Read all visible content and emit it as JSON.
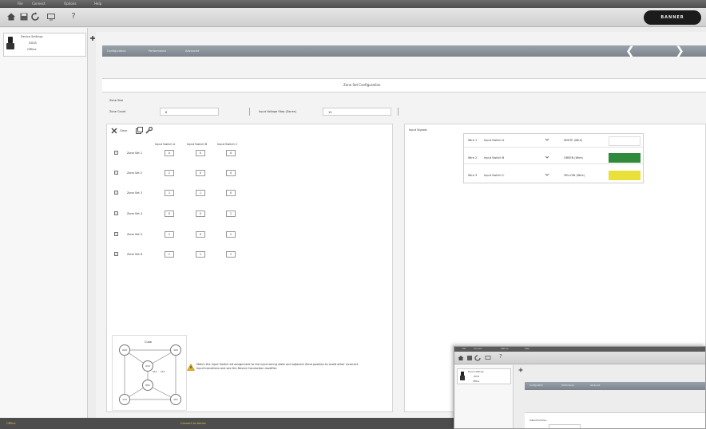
{
  "menu": {
    "items": [
      "File",
      "Connect",
      "Options",
      "Help"
    ]
  },
  "toolbar": {
    "icons": [
      "home-icon",
      "save-icon",
      "refresh-icon",
      "monitor-icon",
      "help-icon"
    ],
    "help_glyph": "?"
  },
  "brand": {
    "logo_text": "BANNER"
  },
  "device": {
    "name": "Device Settings",
    "model": "DXI-B",
    "status": "Offline"
  },
  "nav": {
    "tabs": [
      "Configuration",
      "Performance",
      "Advanced"
    ],
    "prev_glyph": "❮",
    "next_glyph": "❯"
  },
  "page": {
    "title": "Zone Set Configuration"
  },
  "zone_size": {
    "section_label": "Zone Size",
    "count_label": "Zone Count",
    "count_value": "6",
    "volt_label": "Input Voltage Step (Zones)",
    "volt_value": "10"
  },
  "zones": {
    "clear_label": "Clear",
    "columns": [
      "Input Switch A",
      "Input Switch B",
      "Input Switch C"
    ],
    "rows": [
      {
        "label": "Zone Set 1",
        "values": [
          "0",
          "0",
          "0"
        ]
      },
      {
        "label": "Zone Set 2",
        "values": [
          "1",
          "0",
          "0"
        ]
      },
      {
        "label": "Zone Set 3",
        "values": [
          "1",
          "1",
          "0"
        ]
      },
      {
        "label": "Zone Set 4",
        "values": [
          "0",
          "0",
          "1"
        ]
      },
      {
        "label": "Zone Set 5",
        "values": [
          "1",
          "0",
          "1"
        ]
      },
      {
        "label": "Zone Set 6",
        "values": [
          "1",
          "1",
          "1"
        ]
      }
    ]
  },
  "input_signals": {
    "title": "Input Signals",
    "rows": [
      {
        "slot": "Wire 1",
        "source": "Input Switch A",
        "signal": "WHITE (Wire)",
        "color": ""
      },
      {
        "slot": "Wire 2",
        "source": "Input Switch B",
        "signal": "GREEN (Wire)",
        "color": "#2f8a3c"
      },
      {
        "slot": "Wire 3",
        "source": "Input Switch C",
        "signal": "YELLOW (Wire)",
        "color": "#e9e03a"
      }
    ]
  },
  "diagram": {
    "title": "Cube",
    "nodes": [
      "000",
      "100",
      "010",
      "001",
      "110",
      "101",
      "011",
      "111"
    ]
  },
  "warning": {
    "text": "Match the Input Switch bit assignment to the input wiring state and adjacent Zone position to avoid other incorrect Input transitions and see the Device Conduction modifier."
  },
  "status": {
    "left": "Offline",
    "center": "Connect to device"
  },
  "inset": {
    "menu": [
      "File",
      "Connect",
      "Options",
      "Help"
    ],
    "device_name": "Device Settings",
    "device_model": "DXI-B",
    "device_status": "Offline",
    "tabs": [
      "Configuration",
      "Performance",
      "Advanced"
    ],
    "section": "Output Functions"
  }
}
